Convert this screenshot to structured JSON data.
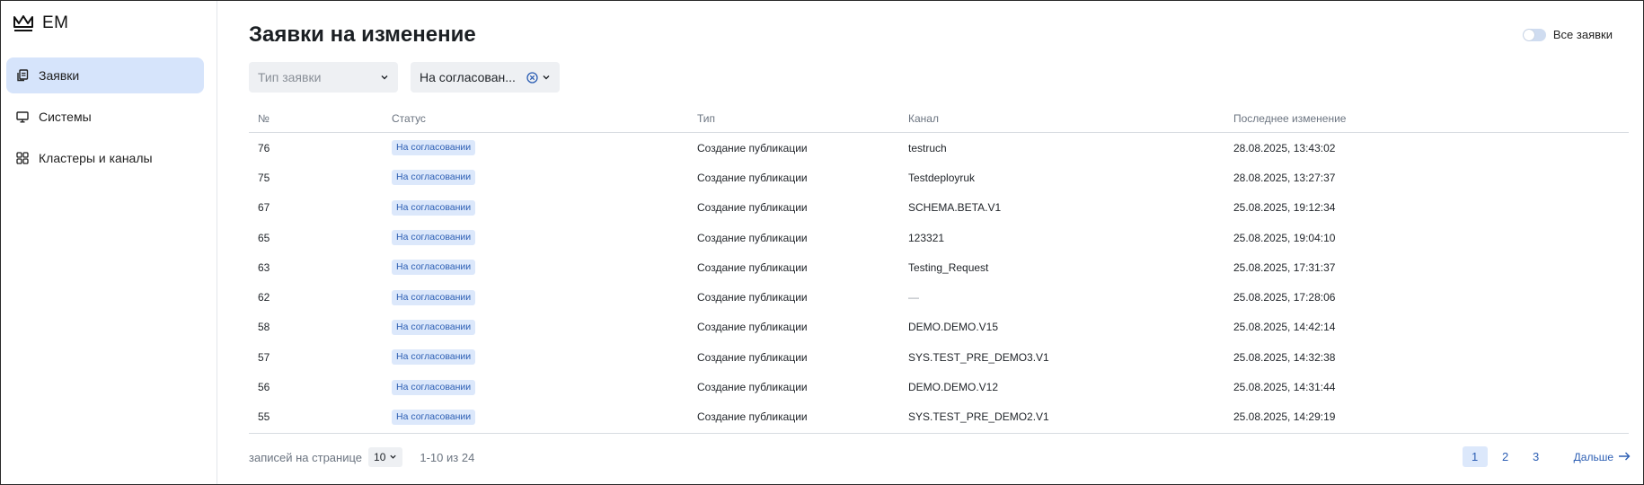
{
  "app": {
    "logo_text": "EM"
  },
  "sidebar": {
    "items": [
      {
        "label": "Заявки",
        "icon": "copy-document-icon",
        "active": true
      },
      {
        "label": "Системы",
        "icon": "monitor-icon",
        "active": false
      },
      {
        "label": "Кластеры и каналы",
        "icon": "grid-icon",
        "active": false
      }
    ]
  },
  "page": {
    "title": "Заявки на изменение"
  },
  "toggle": {
    "label": "Все заявки",
    "on": false
  },
  "filters": {
    "type_placeholder": "Тип заявки",
    "status_value": "На согласован..."
  },
  "table": {
    "headers": {
      "num": "№",
      "status": "Статус",
      "type": "Тип",
      "channel": "Канал",
      "changed": "Последнее изменение"
    },
    "rows": [
      {
        "num": "76",
        "status": "На согласовании",
        "type": "Создание публикации",
        "channel": "testruch",
        "changed": "28.08.2025, 13:43:02"
      },
      {
        "num": "75",
        "status": "На согласовании",
        "type": "Создание публикации",
        "channel": "Testdeployruk",
        "changed": "28.08.2025, 13:27:37"
      },
      {
        "num": "67",
        "status": "На согласовании",
        "type": "Создание публикации",
        "channel": "SCHEMA.BETA.V1",
        "changed": "25.08.2025, 19:12:34"
      },
      {
        "num": "65",
        "status": "На согласовании",
        "type": "Создание публикации",
        "channel": "123321",
        "changed": "25.08.2025, 19:04:10"
      },
      {
        "num": "63",
        "status": "На согласовании",
        "type": "Создание публикации",
        "channel": "Testing_Request",
        "changed": "25.08.2025, 17:31:37"
      },
      {
        "num": "62",
        "status": "На согласовании",
        "type": "Создание публикации",
        "channel": "—",
        "changed": "25.08.2025, 17:28:06"
      },
      {
        "num": "58",
        "status": "На согласовании",
        "type": "Создание публикации",
        "channel": "DEMO.DEMO.V15",
        "changed": "25.08.2025, 14:42:14"
      },
      {
        "num": "57",
        "status": "На согласовании",
        "type": "Создание публикации",
        "channel": "SYS.TEST_PRE_DEMO3.V1",
        "changed": "25.08.2025, 14:32:38"
      },
      {
        "num": "56",
        "status": "На согласовании",
        "type": "Создание публикации",
        "channel": "DEMO.DEMO.V12",
        "changed": "25.08.2025, 14:31:44"
      },
      {
        "num": "55",
        "status": "На согласовании",
        "type": "Создание публикации",
        "channel": "SYS.TEST_PRE_DEMO2.V1",
        "changed": "25.08.2025, 14:29:19"
      }
    ]
  },
  "footer": {
    "per_page_label": "записей на странице",
    "per_page_value": "10",
    "range_text": "1-10 из 24",
    "pages": [
      "1",
      "2",
      "3"
    ],
    "current_page": "1",
    "next_label": "Дальше"
  },
  "colors": {
    "accent": "#2d5fb4",
    "active_nav_bg": "#d6e4fb",
    "badge_bg": "#dce8fb",
    "field_bg": "#eef0f3"
  }
}
